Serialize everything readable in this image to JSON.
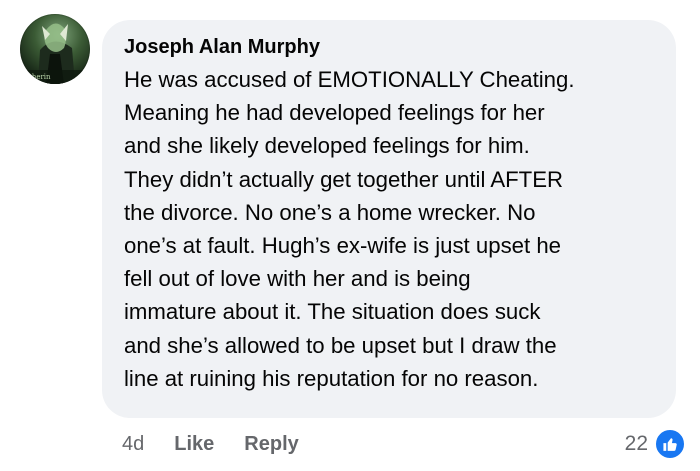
{
  "comment": {
    "author": "Joseph Alan Murphy",
    "lines": [
      "He was accused of EMOTIONALLY Cheating.",
      "Meaning he had developed feelings for her",
      "and she likely developed feelings for him.",
      "They didn’t actually get together until AFTER",
      "the divorce. No one’s a home wrecker. No",
      "one’s at fault. Hugh’s ex-wife is just upset he",
      "fell out of love with her and is being",
      "immature about it. The situation does suck",
      "and she’s allowed to be upset but I draw the",
      "line at ruining his reputation for no reason."
    ]
  },
  "avatar": {
    "icon": "profile-picture",
    "caption": "therin"
  },
  "actions": {
    "time": "4d",
    "like_label": "Like",
    "reply_label": "Reply"
  },
  "reactions": {
    "count": "22",
    "icon": "thumbs-up-icon",
    "color": "#1877f2"
  },
  "colors": {
    "bubble": "#f0f2f5",
    "text": "#050505",
    "meta": "#65676b"
  }
}
